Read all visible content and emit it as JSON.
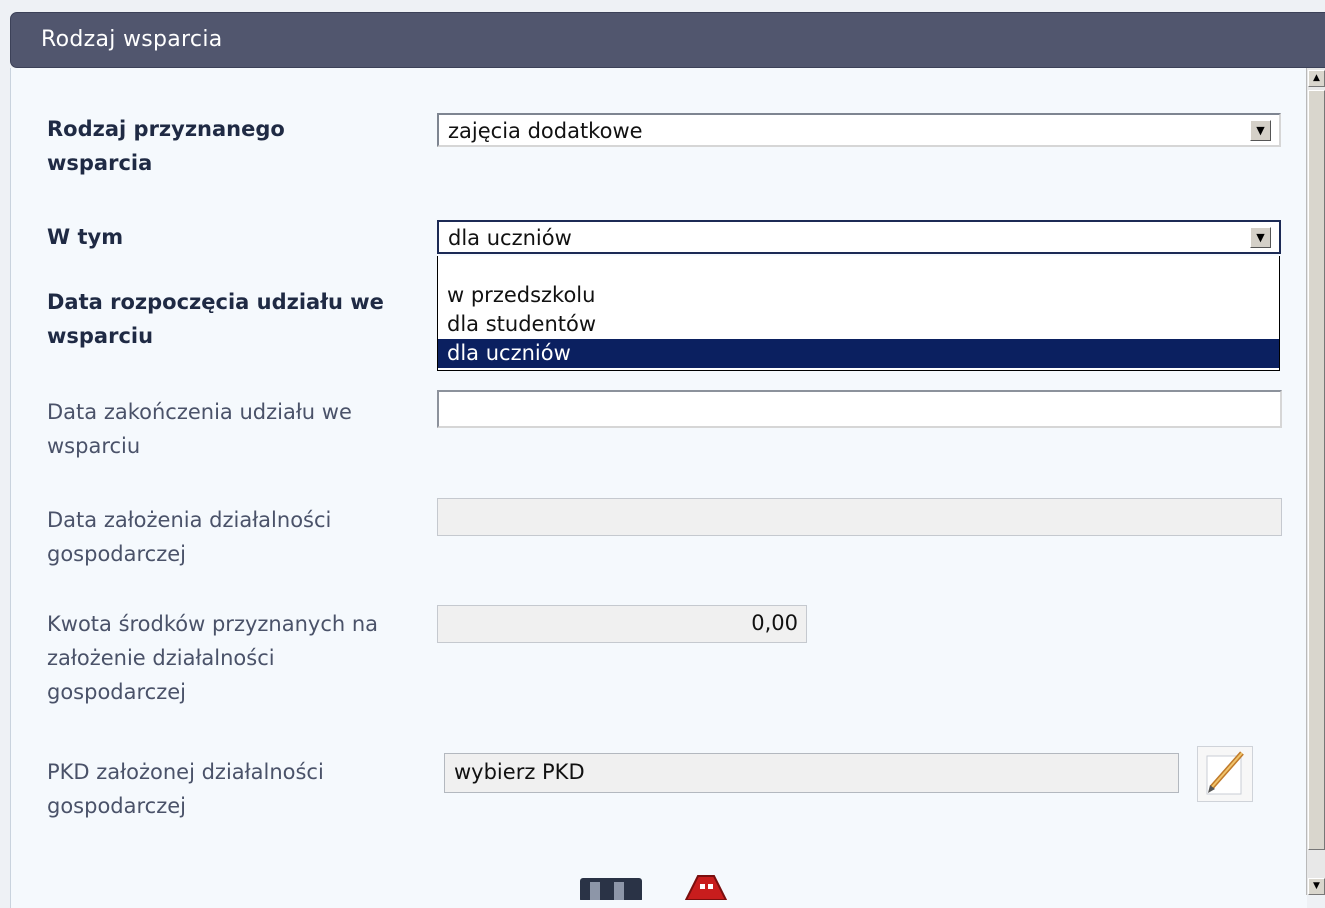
{
  "header": {
    "title": "Rodzaj wsparcia"
  },
  "form": {
    "support_type": {
      "label": "Rodzaj przyznanego wsparcia",
      "value": "zajęcia dodatkowe"
    },
    "including": {
      "label": "W tym",
      "value": "dla uczniów",
      "options": [
        "",
        "w przedszkolu",
        "dla studentów",
        "dla uczniów"
      ],
      "selected_index": 3
    },
    "start_date": {
      "label": "Data rozpoczęcia udziału we wsparciu"
    },
    "end_date": {
      "label": "Data zakończenia udziału we wsparciu",
      "value": ""
    },
    "business_founding_date": {
      "label": "Data założenia działalności gospodarczej",
      "value": ""
    },
    "funds_amount": {
      "label": "Kwota środków przyznanych na założenie działalności gospodarczej",
      "value": "0,00"
    },
    "pkd": {
      "label": "PKD założonej działalności gospodarczej",
      "value": "wybierz PKD"
    }
  },
  "icons": {
    "dropdown_arrow": "chevron-down-icon",
    "edit": "pencil-icon",
    "save": "floppy-disk-icon",
    "cancel": "stop-sign-icon"
  },
  "colors": {
    "header_bg": "#51566e",
    "panel_bg": "#f5f9fd",
    "selected_option_bg": "#0b2060",
    "label_text": "#1f2a44"
  }
}
